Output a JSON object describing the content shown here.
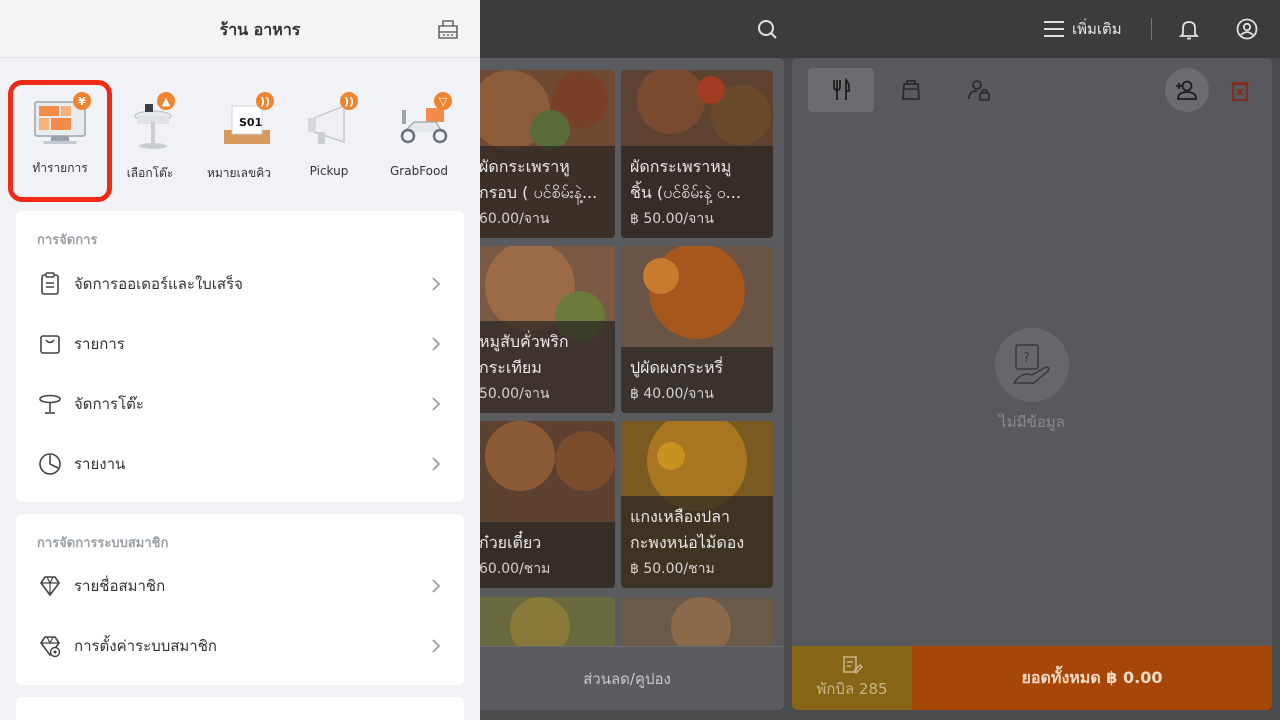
{
  "drawer": {
    "store_name": "ร้าน อาหาร",
    "shortcuts": [
      {
        "label": "ทำรายการ",
        "icon": "pos-terminal-icon",
        "badge": "¥"
      },
      {
        "label": "เลือกโต๊ะ",
        "icon": "table-icon",
        "badge": "▲"
      },
      {
        "label": "หมายเลขคิว",
        "icon": "queue-ticket-icon",
        "badge": "))",
        "ticket_text": "S01"
      },
      {
        "label": "Pickup",
        "icon": "megaphone-icon",
        "badge": "))"
      },
      {
        "label": "GrabFood",
        "icon": "delivery-scooter-icon",
        "badge": "▽"
      }
    ],
    "management": {
      "title": "การจัดการ",
      "items": [
        {
          "label": "จัดการออเดอร์และใบเสร็จ",
          "icon": "clipboard-icon"
        },
        {
          "label": "รายการ",
          "icon": "shopping-bag-icon"
        },
        {
          "label": "จัดการโต๊ะ",
          "icon": "table-icon"
        },
        {
          "label": "รายงาน",
          "icon": "pie-chart-icon"
        }
      ]
    },
    "membership": {
      "title": "การจัดการระบบสมาชิก",
      "items": [
        {
          "label": "รายชื่อสมาชิก",
          "icon": "diamond-icon"
        },
        {
          "label": "การตั้งค่าระบบสมาชิก",
          "icon": "diamond-settings-icon"
        }
      ]
    }
  },
  "topbar": {
    "more_label": "เพิ่มเติม"
  },
  "menu": {
    "items": [
      {
        "name": "ผัดกระเพราหู",
        "name2": "กรอบ ( ပင်စိမ်းနဲ့...",
        "price": "60.00/จาน"
      },
      {
        "name": "ผัดกระเพราหมู",
        "name2": "ชิ้น (ပင်စိမ်းနဲ့ ဝ...",
        "price": "฿ 50.00/จาน"
      },
      {
        "name": "หมูสับคั่วพริก",
        "name2": "กระเทียม",
        "price": "50.00/จาน"
      },
      {
        "name": "ปูผัดผงกระหรี่",
        "name2": "",
        "price": "฿ 40.00/จาน"
      },
      {
        "name": "ก๋วยเตี๋ยว",
        "name2": "",
        "price": "60.00/ชาม"
      },
      {
        "name": "แกงเหลืองปลา",
        "name2": "กะพงหน่อไม้ดอง",
        "price": "฿ 50.00/ชาม"
      }
    ],
    "discount_label": "ส่วนลด/คูปอง"
  },
  "order": {
    "empty_text": "ไม่มีข้อมูล",
    "hold_label": "พักบิล 285",
    "total_label": "ยอดทั้งหมด ฿ 0.00"
  },
  "colors": {
    "highlight_border": "#ef2a16",
    "badge": "#f0832e",
    "total_button": "#a64707",
    "hold_button": "#866517"
  }
}
